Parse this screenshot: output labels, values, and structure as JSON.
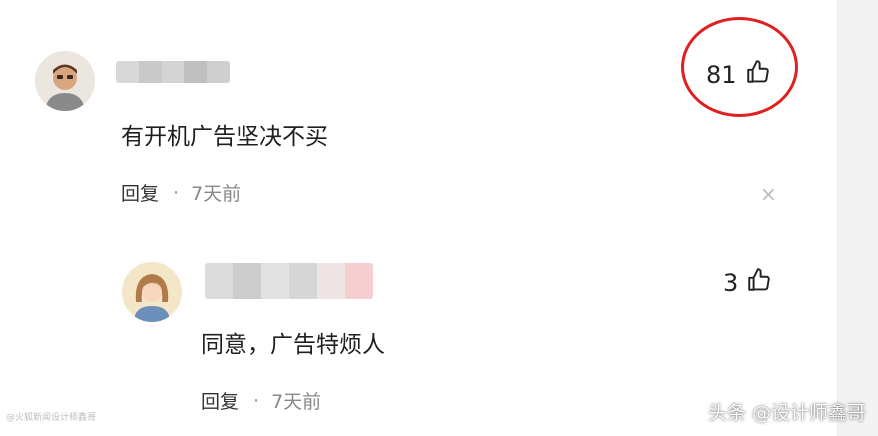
{
  "comments": [
    {
      "text": "有开机广告坚决不买",
      "reply_label": "回复",
      "separator": "·",
      "time": "7天前",
      "likes": "81"
    }
  ],
  "replies": [
    {
      "text": "同意，广告特烦人",
      "reply_label": "回复",
      "separator": "·",
      "time": "7天前",
      "likes": "3"
    }
  ],
  "close_glyph": "×",
  "watermark_left": "@火狐新闻设计师鑫哥",
  "watermark_right": "头条 @设计师鑫哥",
  "highlight_color": "#e02020"
}
